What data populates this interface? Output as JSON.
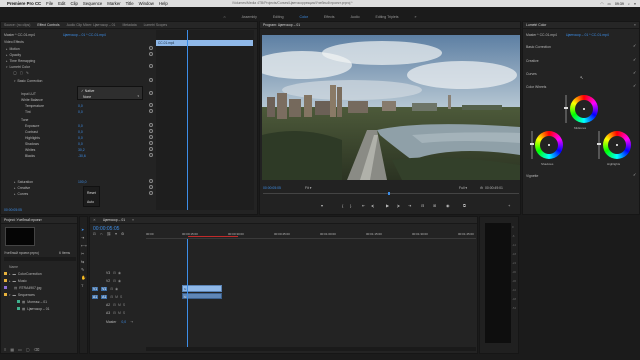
{
  "menubar": {
    "app": "Premiere Pro CC",
    "items": [
      "File",
      "Edit",
      "Clip",
      "Sequence",
      "Marker",
      "Title",
      "Window",
      "Help"
    ],
    "path": "/Volumes/Media 4TB/Projects/Curses/Цветокоррекция/Учебный проект.prproj *",
    "time": "09:39"
  },
  "workspaces": [
    "Assembly",
    "Editing",
    "Color",
    "Effects",
    "Audio",
    "Editing Triplets"
  ],
  "effect_controls": {
    "tabs": [
      "Source: (no clips)",
      "Effect Controls",
      "Audio Clip Mixer: Цветокор – 01",
      "Metadata",
      "Lumetri Scopes"
    ],
    "source": "Master * CC-01.mp4",
    "clip": "Цветокор – 01 * CC-01.mp4",
    "video_effects": "Video Effects",
    "fx": [
      "Motion",
      "Opacity",
      "Time Remapping",
      "Lumetri Color"
    ],
    "basic_correction": "Basic Correction",
    "input_lut": "Input LUT",
    "input_lut_value": "None",
    "white_balance": "White Balance",
    "temperature": "Temperature",
    "temperature_value": "0,0",
    "tint": "Tint",
    "tint_value": "0,0",
    "tone": "Tone",
    "exposure": "Exposure",
    "exposure_value": "0,0",
    "contrast": "Contrast",
    "contrast_value": "0,0",
    "highlights": "Highlights",
    "highlights_value": "0,0",
    "shadows": "Shadows",
    "shadows_value": "0,0",
    "whites": "Whites",
    "whites_value": "30,2",
    "blacks": "Blacks",
    "blacks_value": "-30,6",
    "saturation": "Saturation",
    "saturation_value": "100,0",
    "creative": "Creative",
    "curves": "Curves",
    "timecode": "00:00:05:05",
    "lut_menu": [
      "✓ Native",
      "None"
    ],
    "popup": [
      "Reset",
      "Auto"
    ],
    "mini_clip": "CC-01.mp4"
  },
  "program": {
    "title": "Program: Цветокор – 01",
    "timecode": "00:00:05:05",
    "fit": "Fit",
    "quality": "Full",
    "duration": "00:00:49:01"
  },
  "lumetri": {
    "title": "Lumetri Color",
    "source": "Master * CC-01.mp4",
    "clip": "Цветокор – 01 * CC-01.mp4",
    "sections": [
      "Basic Correction",
      "Creative",
      "Curves",
      "Color Wheels",
      "Vignette"
    ],
    "midtones": "Midtones",
    "shadows": "Shadows",
    "highlights": "Highlights"
  },
  "project": {
    "title": "Project: Учебный проект",
    "file": "Учебный проект.prproj",
    "count": "6 Items",
    "name_header": "Name",
    "items": [
      {
        "name": "ColorCorrection",
        "color": "#e8b23c"
      },
      {
        "name": "Music",
        "color": "#e8b23c"
      },
      {
        "name": "RTRA4907.jpg",
        "color": "#8c6fd6"
      },
      {
        "name": "Sequences",
        "color": "#e8b23c"
      },
      {
        "name": "Монтаж – 01",
        "color": "#3fb08e"
      },
      {
        "name": "Цветокор – 01",
        "color": "#3fb08e"
      }
    ]
  },
  "timeline": {
    "title": "Цветокор – 01",
    "timecode": "00:00:05:05",
    "ruler": [
      "00:00",
      "00:00:15:00",
      "00:00:30:00",
      "00:00:45:00",
      "00:01:00:00",
      "00:01:15:00",
      "00:01:30:00",
      "00:01:45:00"
    ],
    "tracks": [
      "V3",
      "V2",
      "V1",
      "A1",
      "A2",
      "A3"
    ],
    "master": "Master",
    "master_value": "0,0"
  }
}
